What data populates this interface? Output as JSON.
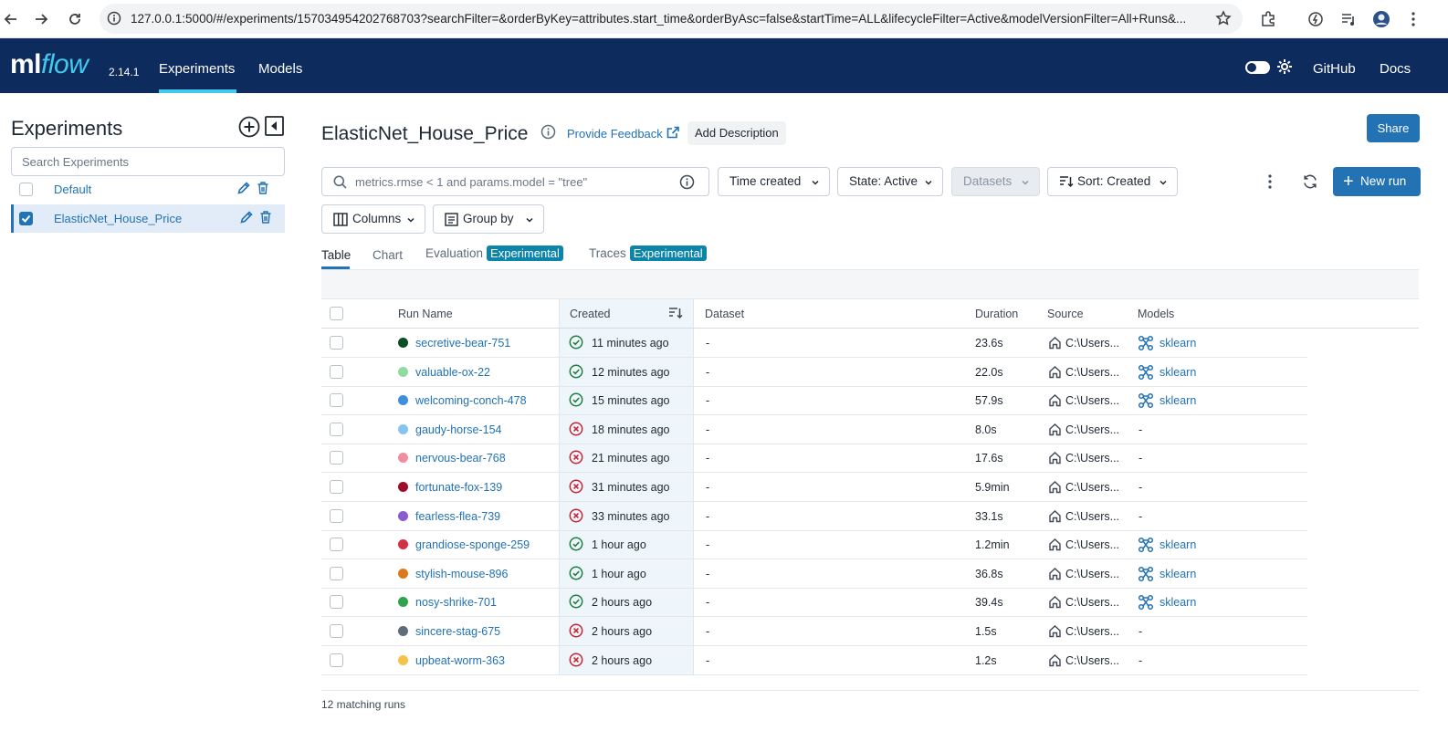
{
  "browser": {
    "url": "127.0.0.1:5000/#/experiments/157034954202768703?searchFilter=&orderByKey=attributes.start_time&orderByAsc=false&startTime=ALL&lifecycleFilter=Active&modelVersionFilter=All+Runs&..."
  },
  "header": {
    "logo_ml": "ml",
    "logo_flow": "flow",
    "version": "2.14.1",
    "tabs": [
      {
        "label": "Experiments"
      },
      {
        "label": "Models"
      }
    ],
    "links": [
      {
        "label": "GitHub"
      },
      {
        "label": "Docs"
      }
    ],
    "bg_color": "#0e2b5e",
    "accent_color": "#43c9ed"
  },
  "sidebar": {
    "title": "Experiments",
    "search_placeholder": "Search Experiments",
    "experiments": [
      {
        "name": "Default",
        "selected": false
      },
      {
        "name": "ElasticNet_House_Price",
        "selected": true
      }
    ]
  },
  "main": {
    "title": "ElasticNet_House_Price",
    "feedback_label": "Provide Feedback",
    "add_description_label": "Add Description",
    "share_label": "Share",
    "search_placeholder": "metrics.rmse < 1 and params.model = \"tree\"",
    "filters": {
      "time": "Time created",
      "state": "State: Active",
      "datasets": "Datasets",
      "sort": "Sort: Created",
      "columns": "Columns",
      "group_by": "Group by"
    },
    "new_run_label": "New run",
    "view_tabs": [
      {
        "label": "Table",
        "badge": ""
      },
      {
        "label": "Chart",
        "badge": ""
      },
      {
        "label": "Evaluation",
        "badge": "Experimental"
      },
      {
        "label": "Traces",
        "badge": "Experimental"
      }
    ],
    "table": {
      "columns": [
        "Run Name",
        "Created",
        "Dataset",
        "Duration",
        "Source",
        "Models"
      ],
      "rows": [
        {
          "name": "secretive-bear-751",
          "color": "#0b4f26",
          "status": "success",
          "created": "11 minutes ago",
          "dataset": "-",
          "duration": "23.6s",
          "source": "C:\\Users...",
          "model": "sklearn"
        },
        {
          "name": "valuable-ox-22",
          "color": "#8fdca0",
          "status": "success",
          "created": "12 minutes ago",
          "dataset": "-",
          "duration": "22.0s",
          "source": "C:\\Users...",
          "model": "sklearn"
        },
        {
          "name": "welcoming-conch-478",
          "color": "#3d8fdc",
          "status": "success",
          "created": "15 minutes ago",
          "dataset": "-",
          "duration": "57.9s",
          "source": "C:\\Users...",
          "model": "sklearn"
        },
        {
          "name": "gaudy-horse-154",
          "color": "#86c4f0",
          "status": "failed",
          "created": "18 minutes ago",
          "dataset": "-",
          "duration": "8.0s",
          "source": "C:\\Users...",
          "model": "-"
        },
        {
          "name": "nervous-bear-768",
          "color": "#f08ea0",
          "status": "failed",
          "created": "21 minutes ago",
          "dataset": "-",
          "duration": "17.6s",
          "source": "C:\\Users...",
          "model": "-"
        },
        {
          "name": "fortunate-fox-139",
          "color": "#9b0f2b",
          "status": "failed",
          "created": "31 minutes ago",
          "dataset": "-",
          "duration": "5.9min",
          "source": "C:\\Users...",
          "model": "-"
        },
        {
          "name": "fearless-flea-739",
          "color": "#8b5ccf",
          "status": "failed",
          "created": "33 minutes ago",
          "dataset": "-",
          "duration": "33.1s",
          "source": "C:\\Users...",
          "model": "-"
        },
        {
          "name": "grandiose-sponge-259",
          "color": "#d13243",
          "status": "success",
          "created": "1 hour ago",
          "dataset": "-",
          "duration": "1.2min",
          "source": "C:\\Users...",
          "model": "sklearn"
        },
        {
          "name": "stylish-mouse-896",
          "color": "#db7a1c",
          "status": "success",
          "created": "1 hour ago",
          "dataset": "-",
          "duration": "36.8s",
          "source": "C:\\Users...",
          "model": "sklearn"
        },
        {
          "name": "nosy-shrike-701",
          "color": "#2fa34d",
          "status": "success",
          "created": "2 hours ago",
          "dataset": "-",
          "duration": "39.4s",
          "source": "C:\\Users...",
          "model": "sklearn"
        },
        {
          "name": "sincere-stag-675",
          "color": "#5f6b78",
          "status": "failed",
          "created": "2 hours ago",
          "dataset": "-",
          "duration": "1.5s",
          "source": "C:\\Users...",
          "model": "-"
        },
        {
          "name": "upbeat-worm-363",
          "color": "#f5c34a",
          "status": "failed",
          "created": "2 hours ago",
          "dataset": "-",
          "duration": "1.2s",
          "source": "C:\\Users...",
          "model": "-"
        }
      ]
    },
    "matching_runs": "12 matching runs"
  },
  "colors": {
    "link": "#2272b4",
    "success": "#1e7d3f",
    "failure": "#c82333"
  }
}
